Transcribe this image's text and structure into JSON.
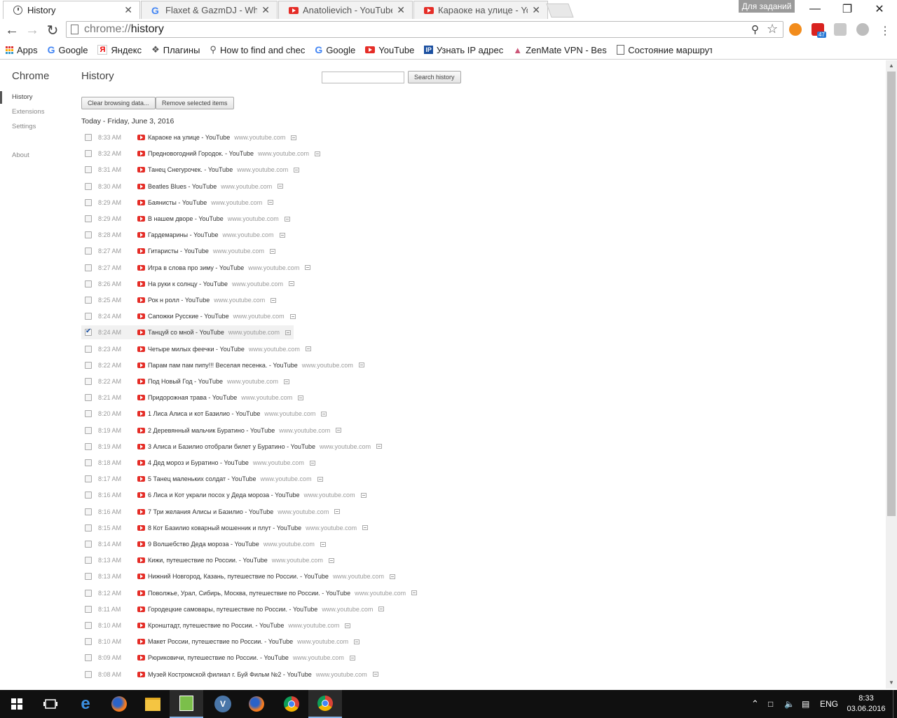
{
  "tabs": [
    {
      "title": "History",
      "icon": "history-icon",
      "active": true
    },
    {
      "title": "Flaxet & GazmDJ - White",
      "icon": "google-icon",
      "active": false
    },
    {
      "title": "Anatolievich - YouTube",
      "icon": "youtube-icon",
      "active": false
    },
    {
      "title": "Караоке на улице - YouT",
      "icon": "youtube-icon",
      "active": false
    }
  ],
  "profile_badge": "Для заданий",
  "omnibox": {
    "scheme": "chrome://",
    "path": "history"
  },
  "bookmarks": [
    {
      "label": "Apps",
      "icon": "apps-grid-icon"
    },
    {
      "label": "Google",
      "icon": "google-icon"
    },
    {
      "label": "Яндекс",
      "icon": "yandex-icon"
    },
    {
      "label": "Плагины",
      "icon": "puzzle-icon"
    },
    {
      "label": "How to find and check",
      "icon": "search-icon"
    },
    {
      "label": "Google",
      "icon": "google-icon"
    },
    {
      "label": "YouTube",
      "icon": "youtube-icon"
    },
    {
      "label": "Узнать IP адрес",
      "icon": "ip-icon"
    },
    {
      "label": "ZenMate VPN - Best C",
      "icon": "zenmate-icon"
    },
    {
      "label": "Состояние маршрути",
      "icon": "page-icon"
    }
  ],
  "sidebar": {
    "title": "Chrome",
    "items": [
      {
        "label": "History",
        "selected": true
      },
      {
        "label": "Extensions",
        "selected": false
      },
      {
        "label": "Settings",
        "selected": false
      },
      {
        "label": "About",
        "selected": false
      }
    ]
  },
  "main": {
    "title": "History",
    "search_button": "Search history",
    "search_value": "",
    "clear_button": "Clear browsing data...",
    "remove_button": "Remove selected items",
    "day_header": "Today - Friday, June 3, 2016"
  },
  "entries": [
    {
      "time": "8:33 AM",
      "title": "Караоке на улице - YouTube",
      "domain": "www.youtube.com",
      "checked": false
    },
    {
      "time": "8:32 AM",
      "title": "Предновогодний Городок. - YouTube",
      "domain": "www.youtube.com",
      "checked": false
    },
    {
      "time": "8:31 AM",
      "title": "Танец Снегурочек. - YouTube",
      "domain": "www.youtube.com",
      "checked": false
    },
    {
      "time": "8:30 AM",
      "title": "Beatles Blues - YouTube",
      "domain": "www.youtube.com",
      "checked": false
    },
    {
      "time": "8:29 AM",
      "title": "Баянисты - YouTube",
      "domain": "www.youtube.com",
      "checked": false
    },
    {
      "time": "8:29 AM",
      "title": "В нашем дворе - YouTube",
      "domain": "www.youtube.com",
      "checked": false
    },
    {
      "time": "8:28 AM",
      "title": "Гардемарины - YouTube",
      "domain": "www.youtube.com",
      "checked": false
    },
    {
      "time": "8:27 AM",
      "title": "Гитаристы - YouTube",
      "domain": "www.youtube.com",
      "checked": false
    },
    {
      "time": "8:27 AM",
      "title": "Игра в слова про зиму - YouTube",
      "domain": "www.youtube.com",
      "checked": false
    },
    {
      "time": "8:26 AM",
      "title": "На руки к солнцу - YouTube",
      "domain": "www.youtube.com",
      "checked": false
    },
    {
      "time": "8:25 AM",
      "title": "Рок н ролл - YouTube",
      "domain": "www.youtube.com",
      "checked": false
    },
    {
      "time": "8:24 AM",
      "title": "Сапожки Русские - YouTube",
      "domain": "www.youtube.com",
      "checked": false
    },
    {
      "time": "8:24 AM",
      "title": "Танцуй со мной - YouTube",
      "domain": "www.youtube.com",
      "checked": true
    },
    {
      "time": "8:23 AM",
      "title": "Четыре милых феечки - YouTube",
      "domain": "www.youtube.com",
      "checked": false
    },
    {
      "time": "8:22 AM",
      "title": "Парам пам пам пипу!!! Веселая песенка. - YouTube",
      "domain": "www.youtube.com",
      "checked": false
    },
    {
      "time": "8:22 AM",
      "title": "Под Новый Год - YouTube",
      "domain": "www.youtube.com",
      "checked": false
    },
    {
      "time": "8:21 AM",
      "title": "Придорожная трава - YouTube",
      "domain": "www.youtube.com",
      "checked": false
    },
    {
      "time": "8:20 AM",
      "title": "1 Лиса Алиса и кот Базилио - YouTube",
      "domain": "www.youtube.com",
      "checked": false
    },
    {
      "time": "8:19 AM",
      "title": "2 Деревянный мальчик Буратино - YouTube",
      "domain": "www.youtube.com",
      "checked": false
    },
    {
      "time": "8:19 AM",
      "title": "3 Алиса и Базилио отобрали билет у Буратино - YouTube",
      "domain": "www.youtube.com",
      "checked": false
    },
    {
      "time": "8:18 AM",
      "title": "4 Дед мороз и Буратино - YouTube",
      "domain": "www.youtube.com",
      "checked": false
    },
    {
      "time": "8:17 AM",
      "title": "5 Танец маленьких солдат - YouTube",
      "domain": "www.youtube.com",
      "checked": false
    },
    {
      "time": "8:16 AM",
      "title": "6 Лиса и Кот украли посох у Деда мороза - YouTube",
      "domain": "www.youtube.com",
      "checked": false
    },
    {
      "time": "8:16 AM",
      "title": "7 Три желания Алисы и Базилио - YouTube",
      "domain": "www.youtube.com",
      "checked": false
    },
    {
      "time": "8:15 AM",
      "title": "8 Кот Базилио коварный мошенник и плут - YouTube",
      "domain": "www.youtube.com",
      "checked": false
    },
    {
      "time": "8:14 AM",
      "title": "9 Волшебство Деда мороза - YouTube",
      "domain": "www.youtube.com",
      "checked": false
    },
    {
      "time": "8:13 AM",
      "title": "Кижи, путешествие по России. - YouTube",
      "domain": "www.youtube.com",
      "checked": false
    },
    {
      "time": "8:13 AM",
      "title": "Нижний Новгород, Казань, путешествие по России. - YouTube",
      "domain": "www.youtube.com",
      "checked": false
    },
    {
      "time": "8:12 AM",
      "title": "Поволжье, Урал, Сибирь, Москва, путешествие по России. - YouTube",
      "domain": "www.youtube.com",
      "checked": false
    },
    {
      "time": "8:11 AM",
      "title": "Городецкие самовары, путешествие по России. - YouTube",
      "domain": "www.youtube.com",
      "checked": false
    },
    {
      "time": "8:10 AM",
      "title": "Кронштадт, путешествие по России. - YouTube",
      "domain": "www.youtube.com",
      "checked": false
    },
    {
      "time": "8:10 AM",
      "title": "Макет России, путешествие по России. - YouTube",
      "domain": "www.youtube.com",
      "checked": false
    },
    {
      "time": "8:09 AM",
      "title": "Рюриковичи, путешествие по России. - YouTube",
      "domain": "www.youtube.com",
      "checked": false
    },
    {
      "time": "8:08 AM",
      "title": "Музей Костромской филиал г. Буй Фильм №2 - YouTube",
      "domain": "www.youtube.com",
      "checked": false
    }
  ],
  "taskbar": {
    "apps": [
      "windows-start-icon",
      "task-view-icon",
      "edge-icon",
      "firefox-icon",
      "file-explorer-icon",
      "notepad-icon",
      "vk-icon",
      "firefox-icon",
      "chrome-icon",
      "chrome-canary-icon"
    ],
    "language": "ENG",
    "time": "8:33",
    "date": "03.06.2016"
  },
  "extensions": [
    {
      "name": "dollar-extension-icon",
      "badge": ""
    },
    {
      "name": "red-c-extension-icon",
      "badge": "47"
    },
    {
      "name": "shield-extension-icon",
      "badge": ""
    },
    {
      "name": "globe-extension-icon",
      "badge": ""
    }
  ]
}
